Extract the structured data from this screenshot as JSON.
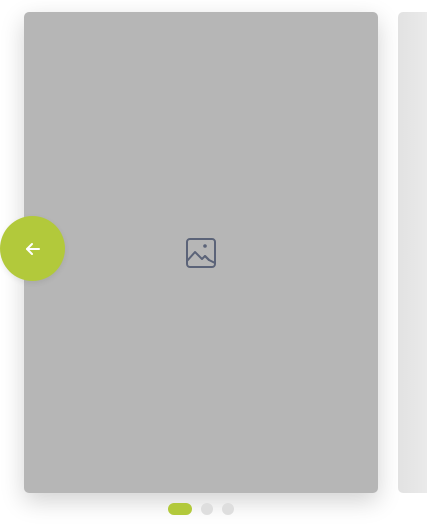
{
  "carousel": {
    "slides": [
      {
        "type": "image-placeholder",
        "icon": "image-icon",
        "active": true
      },
      {
        "type": "image-placeholder",
        "active": false
      }
    ],
    "prev_button": {
      "icon": "arrow-left-icon"
    },
    "pagination": {
      "count": 3,
      "active_index": 0
    }
  },
  "colors": {
    "accent": "#b2c93b",
    "slide_placeholder": "#b6b6b6",
    "icon": "#5b6378",
    "dot_inactive": "#dedede"
  }
}
